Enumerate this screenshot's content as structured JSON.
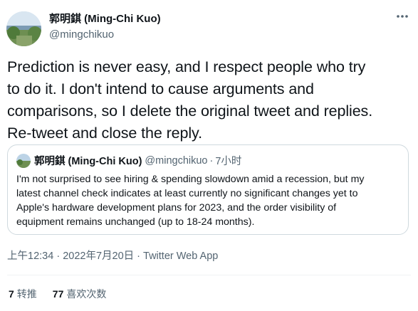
{
  "author": {
    "display_name": "郭明錤 (Ming-Chi Kuo)",
    "handle": "@mingchikuo"
  },
  "icons": {
    "more": "more-horizontal-icon"
  },
  "tweet": {
    "text": "Prediction is never easy, and I respect people who try\nto do it. I don't intend to cause arguments and\ncomparisons, so I delete the original tweet and replies.\nRe-tweet and close the reply."
  },
  "quoted_tweet": {
    "display_name": "郭明錤 (Ming-Chi Kuo)",
    "handle": "@mingchikuo",
    "separator": "·",
    "time": "7小时",
    "text": "I'm not surprised to see hiring & spending slowdown amid a recession, but my\nlatest channel check indicates at least currently no significant changes yet to\nApple's hardware development plans for 2023, and the order visibility of\nequipment remains unchanged (up to 18-24 months)."
  },
  "meta": {
    "time": "上午12:34",
    "sep1": " · ",
    "date": "2022年7月20日",
    "sep2": " · ",
    "source": "Twitter Web App"
  },
  "stats": {
    "retweets_count": "7",
    "retweets_label": "转推",
    "likes_count": "77",
    "likes_label": "喜欢次数"
  }
}
